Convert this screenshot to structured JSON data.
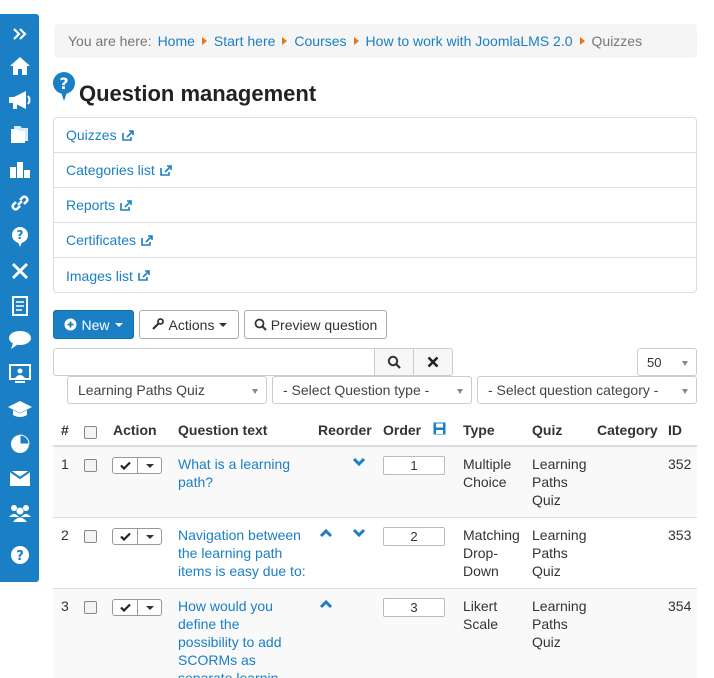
{
  "breadcrumb": {
    "prefix": "You are here:",
    "items": [
      "Home",
      "Start here",
      "Courses",
      "How to work with JoomlaLMS 2.0"
    ],
    "current": "Quizzes"
  },
  "page": {
    "title": "Question management"
  },
  "links": [
    "Quizzes",
    "Categories list",
    "Reports",
    "Certificates",
    "Images list"
  ],
  "toolbar": {
    "new_label": "New",
    "actions_label": "Actions",
    "preview_label": "Preview question"
  },
  "search": {
    "value": "",
    "placeholder": ""
  },
  "limit": {
    "selected": "50"
  },
  "filters": {
    "quiz": "Learning Paths Quiz",
    "question_type": "- Select Question type -",
    "question_category": "- Select question category -"
  },
  "table": {
    "headers": {
      "num": "#",
      "action": "Action",
      "question_text": "Question text",
      "reorder": "Reorder",
      "order": "Order",
      "type": "Type",
      "quiz": "Quiz",
      "category": "Category",
      "id": "ID"
    },
    "rows": [
      {
        "num": "1",
        "text": "What is a learning path?",
        "order": "1",
        "type": "Multiple Choice",
        "quiz": "Learning Paths Quiz",
        "category": "",
        "id": "352",
        "up": false,
        "down": true
      },
      {
        "num": "2",
        "text": "Navigation between the learning path items is easy due to:",
        "order": "2",
        "type": "Matching Drop-Down",
        "quiz": "Learning Paths Quiz",
        "category": "",
        "id": "353",
        "up": true,
        "down": true
      },
      {
        "num": "3",
        "text": "How would you define the possibility to add SCORMs as separate learnin",
        "order": "3",
        "type": "Likert Scale",
        "quiz": "Learning Paths Quiz",
        "category": "",
        "id": "354",
        "up": true,
        "down": false
      }
    ]
  },
  "colors": {
    "accent": "#1a7fc4",
    "breadcrumb_separator": "#e07a1f"
  },
  "sidebar_icons": [
    "expand-icon",
    "home-icon",
    "megaphone-icon",
    "folders-icon",
    "sitemap-icon",
    "link-icon",
    "question-bubble-icon",
    "tools-icon",
    "document-icon",
    "chat-icon",
    "monitor-user-icon",
    "graduation-cap-icon",
    "pie-chart-icon",
    "inbox-icon",
    "users-icon",
    "help-icon"
  ]
}
